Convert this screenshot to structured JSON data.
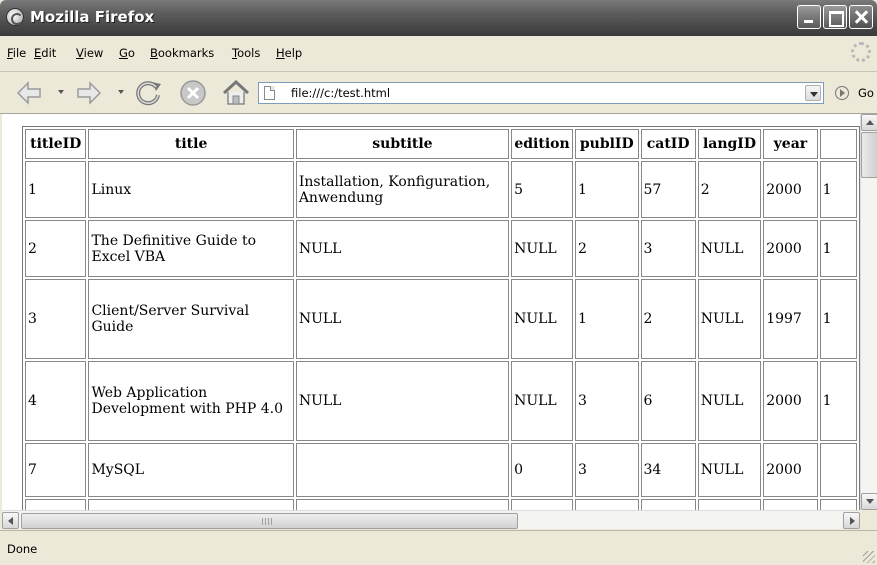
{
  "window": {
    "title": "Mozilla Firefox"
  },
  "menu": [
    "File",
    "Edit",
    "View",
    "Go",
    "Bookmarks",
    "Tools",
    "Help"
  ],
  "address": {
    "url": "file:///c:/test.html",
    "go_label": "Go"
  },
  "table": {
    "headers": [
      "titleID",
      "title",
      "subtitle",
      "edition",
      "publID",
      "catID",
      "langID",
      "year",
      ""
    ],
    "rows": [
      [
        "1",
        "Linux",
        "Installation, Konfiguration, Anwendung",
        "5",
        "1",
        "57",
        "2",
        "2000",
        "1"
      ],
      [
        "2",
        "The Definitive Guide to Excel VBA",
        "NULL",
        "NULL",
        "2",
        "3",
        "NULL",
        "2000",
        "1"
      ],
      [
        "3",
        "Client/Server Survival Guide",
        "NULL",
        "NULL",
        "1",
        "2",
        "NULL",
        "1997",
        "1"
      ],
      [
        "4",
        "Web Application Development with PHP 4.0",
        "NULL",
        "NULL",
        "3",
        "6",
        "NULL",
        "2000",
        "1"
      ],
      [
        "7",
        "MySQL",
        "",
        "0",
        "3",
        "34",
        "NULL",
        "2000",
        ""
      ],
      [
        "",
        "",
        "",
        "",
        "",
        "",
        "",
        "",
        ""
      ]
    ]
  },
  "status": {
    "text": "Done"
  },
  "icons": {
    "app": "firefox-icon",
    "back": "back-arrow-icon",
    "forward": "forward-arrow-icon",
    "reload": "reload-icon",
    "stop": "stop-icon",
    "home": "home-icon",
    "page": "page-icon",
    "go": "go-icon"
  }
}
